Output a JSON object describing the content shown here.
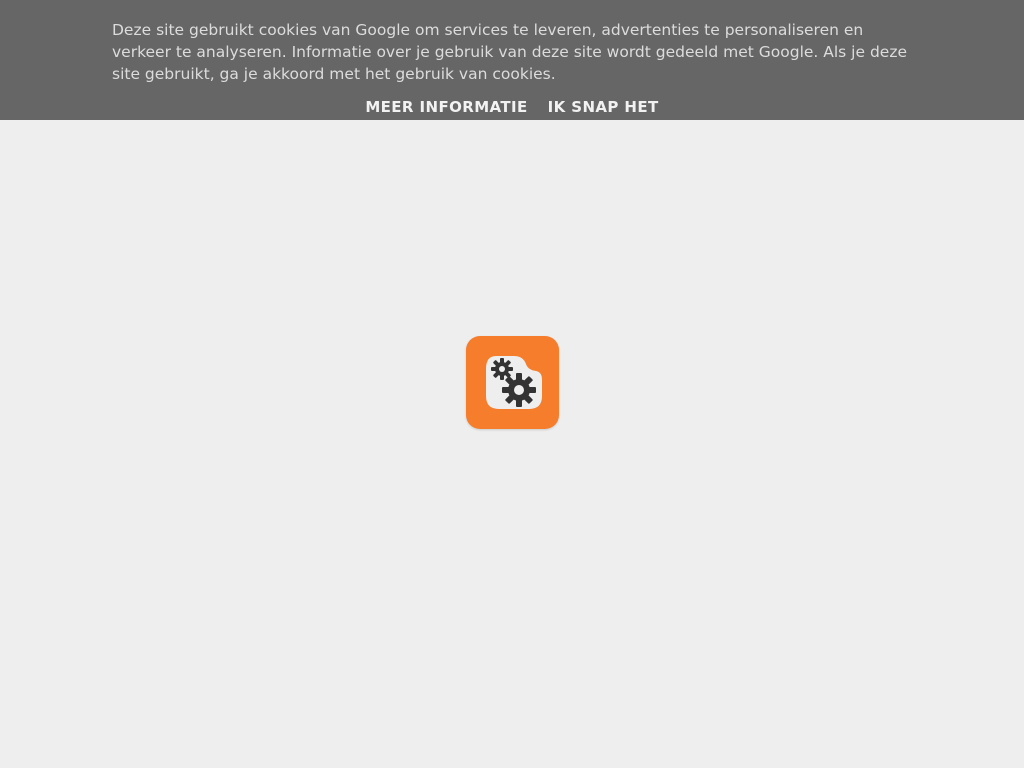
{
  "cookie_notice": {
    "message": "Deze site gebruikt cookies van Google om services te leveren, advertenties te personaliseren en verkeer te analyseren. Informatie over je gebruik van deze site wordt gedeeld met Google. Als je deze site gebruikt, ga je akkoord met het gebruik van cookies.",
    "more_info_label": "MEER INFORMATIE",
    "accept_label": "IK SNAP HET"
  },
  "loader": {
    "icon": "blogger-gears-icon",
    "brand_color": "#f57d2b"
  },
  "colors": {
    "page_background": "#eeeeee",
    "cookie_bar_background": "#666666"
  }
}
